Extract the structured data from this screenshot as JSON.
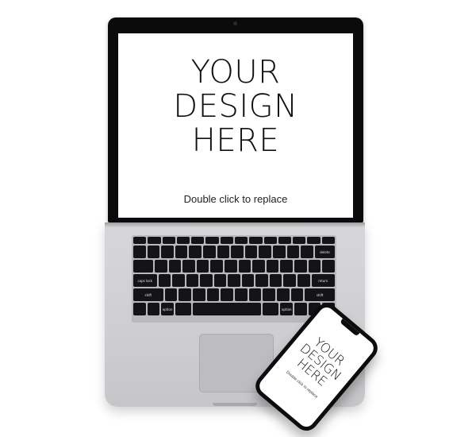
{
  "laptop": {
    "screen": {
      "headline_lines": [
        "YOUR",
        "DESIGN",
        "HERE"
      ],
      "subtext": "Double click to replace"
    },
    "keyboard": {
      "key_labels": {
        "delete": "delete",
        "return": "return",
        "caps_lock": "caps lock",
        "shift": "shift",
        "option": "option"
      }
    }
  },
  "phone": {
    "screen": {
      "headline_lines": [
        "YOUR",
        "DESIGN",
        "HERE"
      ],
      "subtext": "Double click to replace"
    }
  }
}
